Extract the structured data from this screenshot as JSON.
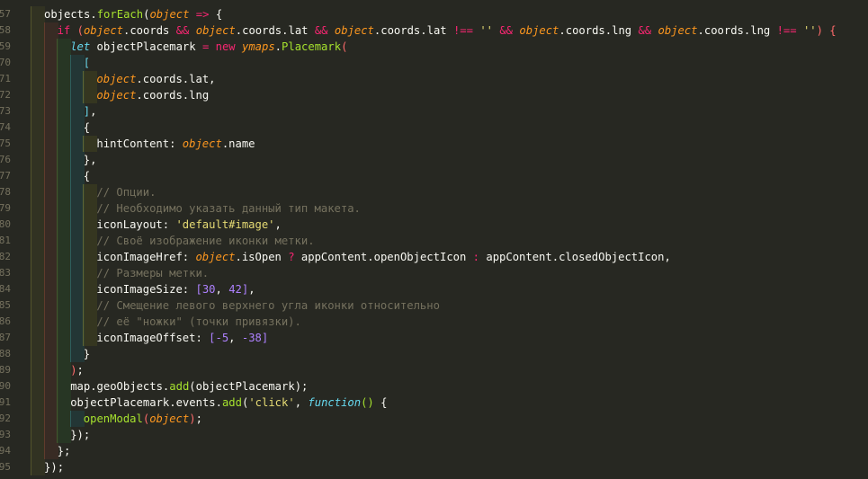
{
  "editor": {
    "theme_colors": {
      "background": "#272822",
      "keyword": "#f92672",
      "function": "#a6e22e",
      "string": "#e6db74",
      "number": "#ae81ff",
      "comment": "#75715e",
      "parameter": "#fd971f",
      "storage": "#66d9ef"
    },
    "lines": [
      {
        "n": "57"
      },
      {
        "n": "58"
      },
      {
        "n": "59"
      },
      {
        "n": "70"
      },
      {
        "n": "71"
      },
      {
        "n": "72"
      },
      {
        "n": "73"
      },
      {
        "n": "74"
      },
      {
        "n": "75"
      },
      {
        "n": "76"
      },
      {
        "n": "77"
      },
      {
        "n": "78"
      },
      {
        "n": "79"
      },
      {
        "n": "80"
      },
      {
        "n": "81"
      },
      {
        "n": "82"
      },
      {
        "n": "83"
      },
      {
        "n": "84"
      },
      {
        "n": "85"
      },
      {
        "n": "86"
      },
      {
        "n": "87"
      },
      {
        "n": "88"
      },
      {
        "n": "89"
      },
      {
        "n": "90"
      },
      {
        "n": "91"
      },
      {
        "n": "92"
      },
      {
        "n": "93"
      },
      {
        "n": "94"
      },
      {
        "n": "95"
      }
    ],
    "tokens": {
      "l0": [
        "objects",
        ".",
        "forEach",
        "(",
        "object",
        " => ",
        "{"
      ],
      "l1": [
        "if",
        " (",
        "object",
        ".",
        "coords",
        " && ",
        "object",
        ".",
        "coords",
        ".",
        "lat",
        " && ",
        "object",
        ".",
        "coords",
        ".",
        "lat",
        " !== ",
        "''",
        " && ",
        "object",
        ".",
        "coords",
        ".",
        "lng",
        " && ",
        "object",
        ".",
        "coords",
        ".",
        "lng",
        " !== ",
        "''",
        ") {"
      ],
      "l2": [
        "let",
        " objectPlacemark",
        " = ",
        "new",
        " ",
        "ymaps",
        ".",
        "Placemark",
        "("
      ],
      "l3": [
        "["
      ],
      "l4": [
        "object",
        ".",
        "coords",
        ".",
        "lat",
        ","
      ],
      "l5": [
        "object",
        ".",
        "coords",
        ".",
        "lng"
      ],
      "l6": [
        "]",
        ","
      ],
      "l7": [
        "{"
      ],
      "l8": [
        "hintContent",
        ": ",
        "object",
        ".",
        "name"
      ],
      "l9": [
        "}",
        ","
      ],
      "l10": [
        "{"
      ],
      "l11": [
        "// Опции."
      ],
      "l12": [
        "// Необходимо указать данный тип макета."
      ],
      "l13": [
        "iconLayout",
        ": ",
        "'default#image'",
        ","
      ],
      "l14": [
        "// Своё изображение иконки метки."
      ],
      "l15": [
        "iconImageHref",
        ": ",
        "object",
        ".",
        "isOpen",
        " ? ",
        "appContent",
        ".",
        "openObjectIcon",
        " : ",
        "appContent",
        ".",
        "closedObjectIcon",
        ","
      ],
      "l16": [
        "// Размеры метки."
      ],
      "l17": [
        "iconImageSize",
        ": ",
        "[",
        "30",
        ", ",
        "42",
        "]",
        ","
      ],
      "l18": [
        "// Смещение левого верхнего угла иконки относительно"
      ],
      "l19": [
        "// её \"ножки\" (точки привязки)."
      ],
      "l20": [
        "iconImageOffset",
        ": ",
        "[",
        "-5",
        ", ",
        "-38",
        "]"
      ],
      "l21": [
        "}"
      ],
      "l22": [
        ")",
        ";"
      ],
      "l23": [
        "map",
        ".",
        "geoObjects",
        ".",
        "add",
        "(",
        "objectPlacemark",
        ")",
        ";"
      ],
      "l24": [
        "objectPlacemark",
        ".",
        "events",
        ".",
        "add",
        "(",
        "'click'",
        ", ",
        "function",
        "()",
        " {"
      ],
      "l25": [
        "openModal",
        "(",
        "object",
        ")",
        ";"
      ],
      "l26": [
        "})",
        ";"
      ],
      "l27": [
        "}",
        ";"
      ],
      "l28": [
        "})",
        ";"
      ]
    }
  }
}
